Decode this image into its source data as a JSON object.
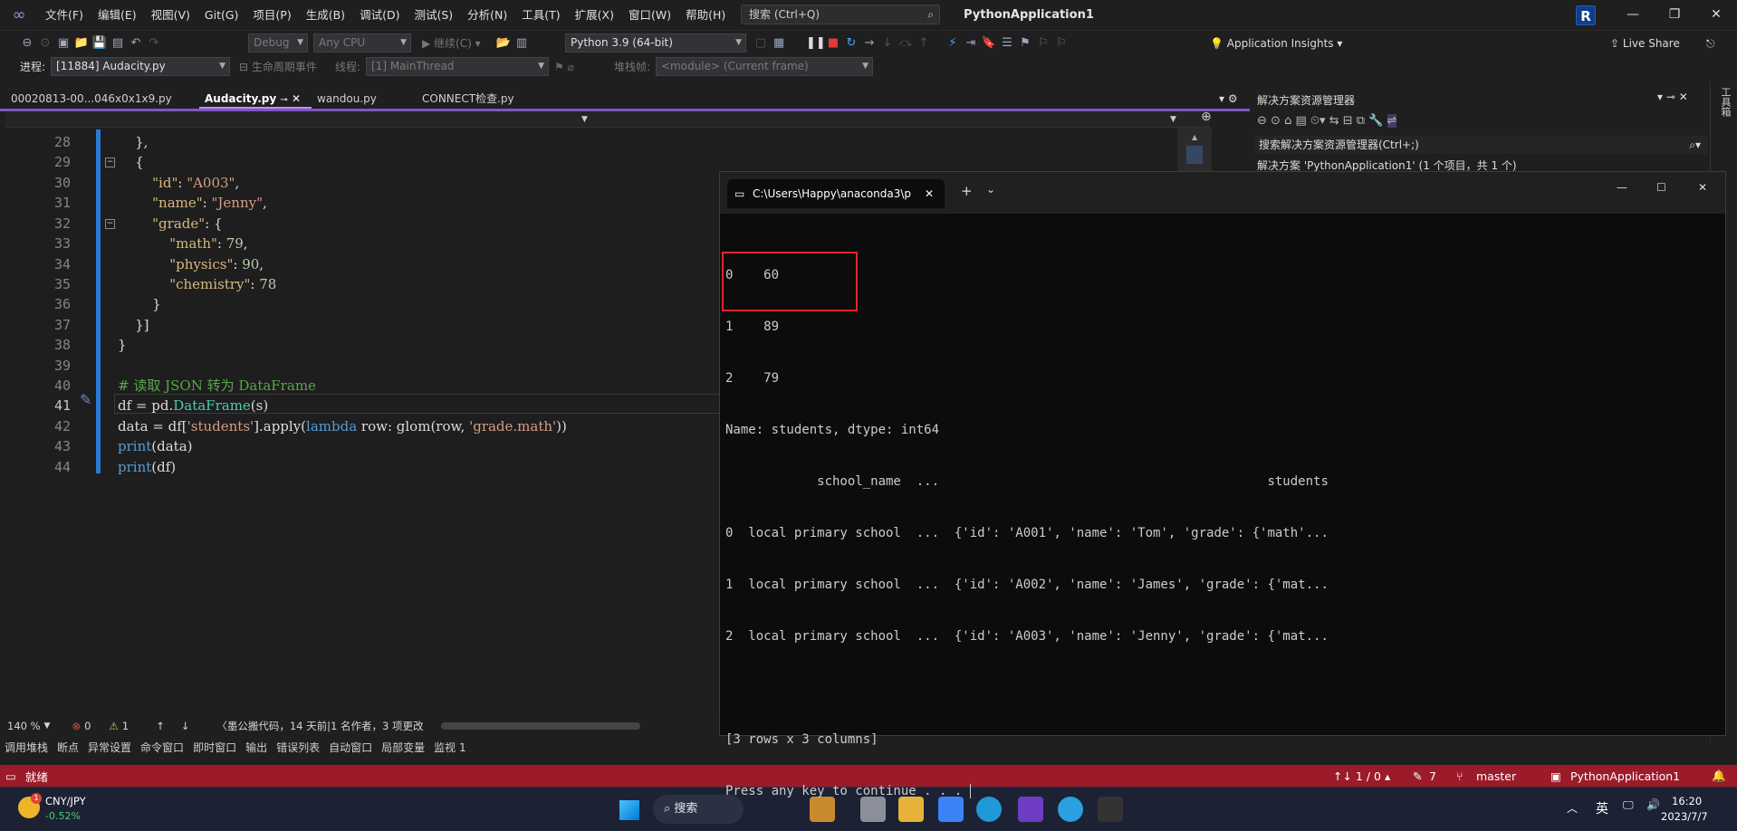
{
  "menubar": {
    "items": [
      "文件(F)",
      "编辑(E)",
      "视图(V)",
      "Git(G)",
      "项目(P)",
      "生成(B)",
      "调试(D)",
      "测试(S)",
      "分析(N)",
      "工具(T)",
      "扩展(X)",
      "窗口(W)",
      "帮助(H)"
    ],
    "search_placeholder": "搜索 (Ctrl+Q)",
    "project_title": "PythonApplication1",
    "avatar_letter": "R"
  },
  "toolbar": {
    "config": "Debug",
    "platform": "Any CPU",
    "continue_label": "继续(C)",
    "python_env": "Python 3.9 (64-bit)",
    "app_insights": "Application Insights",
    "live_share": "Live Share"
  },
  "debugbar": {
    "process_label": "进程:",
    "process_value": "[11884] Audacity.py",
    "lifecycle_label": "生命周期事件",
    "thread_label": "线程:",
    "thread_value": "[1] MainThread",
    "stack_label": "堆栈帧:",
    "stack_value": "<module> (Current frame)"
  },
  "tabs": [
    {
      "label": "00020813-00...046x0x1x9.py"
    },
    {
      "label": "Audacity.py"
    },
    {
      "label": "wandou.py"
    },
    {
      "label": "CONNECT检查.py"
    }
  ],
  "editor": {
    "line_numbers": [
      "28",
      "29",
      "30",
      "31",
      "32",
      "33",
      "34",
      "35",
      "36",
      "37",
      "38",
      "39",
      "40",
      "41",
      "42",
      "43",
      "44"
    ],
    "zoom": "140 %",
    "errors": "0",
    "warnings": "1",
    "blame": "墨公搬代码，14 天前|1 名作者，3 项更改"
  },
  "solution_explorer": {
    "title": "解决方案资源管理器",
    "search": "搜索解决方案资源管理器(Ctrl+;)",
    "solution_item": "解决方案 'PythonApplication1' (1 个项目，共 1 个)"
  },
  "terminal": {
    "title": "C:\\Users\\Happy\\anaconda3\\p",
    "lines": [
      "0    60",
      "1    89",
      "2    79",
      "Name: students, dtype: int64",
      "            school_name  ...                                           students",
      "0  local primary school  ...  {'id': 'A001', 'name': 'Tom', 'grade': {'math'...",
      "1  local primary school  ...  {'id': 'A002', 'name': 'James', 'grade': {'mat...",
      "2  local primary school  ...  {'id': 'A003', 'name': 'Jenny', 'grade': {'mat...",
      "",
      "[3 rows x 3 columns]",
      "Press any key to continue . . . "
    ]
  },
  "tooltabs": [
    "调用堆栈",
    "断点",
    "异常设置",
    "命令窗口",
    "即时窗口",
    "输出",
    "错误列表",
    "自动窗口",
    "局部变量",
    "监视 1"
  ],
  "statusbar": {
    "ready": "就绪",
    "position": "↑↓ 1 / 0 ▴",
    "edits": "7",
    "branch": "master",
    "project": "PythonApplication1"
  },
  "taskbar": {
    "currency": "CNY/JPY",
    "change": "-0.52%",
    "search": "搜索",
    "ime": "英",
    "time": "16:20",
    "date": "2023/7/7"
  }
}
